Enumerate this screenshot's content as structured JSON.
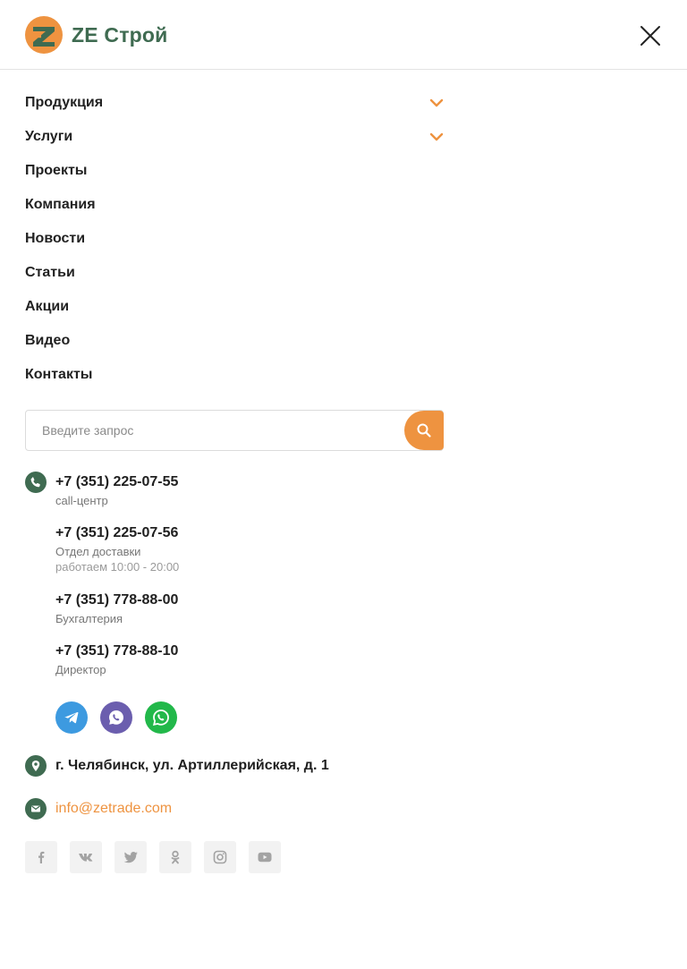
{
  "brand": {
    "name": "ZE Строй",
    "logo_letter": "Z",
    "colors": {
      "accent": "#ee9340",
      "green": "#3f6b51"
    }
  },
  "menu": [
    {
      "label": "Продукция",
      "expandable": true
    },
    {
      "label": "Услуги",
      "expandable": true
    },
    {
      "label": "Проекты",
      "expandable": false
    },
    {
      "label": "Компания",
      "expandable": false
    },
    {
      "label": "Новости",
      "expandable": false
    },
    {
      "label": "Статьи",
      "expandable": false
    },
    {
      "label": "Акции",
      "expandable": false
    },
    {
      "label": "Видео",
      "expandable": false
    },
    {
      "label": "Контакты",
      "expandable": false
    }
  ],
  "search": {
    "placeholder": "Введите запрос",
    "value": ""
  },
  "phones": [
    {
      "number": "+7 (351) 225-07-55",
      "desc": "call-центр"
    },
    {
      "number": "+7 (351) 225-07-56",
      "desc": "Отдел доставки",
      "hours": "работаем 10:00 - 20:00"
    },
    {
      "number": "+7 (351) 778-88-00",
      "desc": "Бухгалтерия"
    },
    {
      "number": "+7 (351) 778-88-10",
      "desc": "Директор"
    }
  ],
  "messengers": [
    {
      "name": "telegram-icon",
      "color": "#3d9ae0"
    },
    {
      "name": "whatsapp-icon",
      "color": "#6b5eae"
    },
    {
      "name": "viber-icon",
      "color": "#22b84a"
    }
  ],
  "address": "г. Челябинск, ул. Артиллерийская, д. 1",
  "email": "info@zetrade.com",
  "socials": [
    "facebook-icon",
    "vk-icon",
    "twitter-icon",
    "odnoklassniki-icon",
    "instagram-icon",
    "youtube-icon"
  ]
}
